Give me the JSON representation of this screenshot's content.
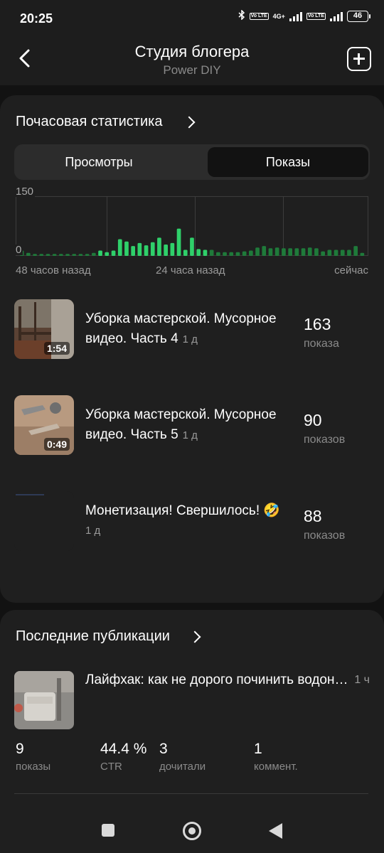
{
  "status_bar": {
    "time": "20:25",
    "network": "4G+",
    "volte": "Vo LTE",
    "battery": "46"
  },
  "header": {
    "title": "Студия блогера",
    "subtitle": "Power DIY",
    "back_icon": "back-arrow-icon",
    "add_icon": "plus-square-icon"
  },
  "hourly": {
    "title": "Почасовая статистика",
    "tabs": [
      {
        "label": "Просмотры",
        "active": false
      },
      {
        "label": "Показы",
        "active": true
      }
    ],
    "chart_data": {
      "type": "bar",
      "ylim": [
        0,
        150
      ],
      "y_ticks": [
        "150",
        "0"
      ],
      "x_ticks": [
        "48 часов назад",
        "24 часа назад",
        "сейчас"
      ],
      "grid": true,
      "colors": {
        "older": "#1f7a3a",
        "recent": "#2fd06a"
      },
      "values": [
        14,
        8,
        5,
        5,
        5,
        5,
        5,
        5,
        5,
        5,
        5,
        8,
        14,
        10,
        14,
        44,
        38,
        26,
        34,
        28,
        36,
        48,
        30,
        34,
        72,
        16,
        48,
        18,
        16,
        16,
        10,
        10,
        10,
        10,
        12,
        14,
        22,
        26,
        20,
        22,
        20,
        20,
        20,
        20,
        22,
        20,
        12,
        16,
        16,
        16,
        16,
        26,
        8
      ],
      "recent_start": 12
    }
  },
  "videos": [
    {
      "title": "Уборка мастерской. Мусорное видео. Часть 4",
      "age": "1 д",
      "duration": "1:54",
      "count": "163",
      "unit": "показа"
    },
    {
      "title": "Уборка мастерской. Мусорное видео. Часть 5",
      "age": "1 д",
      "duration": "0:49",
      "count": "90",
      "unit": "показов"
    },
    {
      "title": "Монетизация! Свершилось! 🤣",
      "age": "1 д",
      "duration": "",
      "count": "88",
      "unit": "показов"
    }
  ],
  "publications": {
    "title": "Последние публикации",
    "item": {
      "title": "Лайфхак: как не дорого починить водонагреватель",
      "age": "1 ч"
    },
    "stats": [
      {
        "value": "9",
        "label": "показы"
      },
      {
        "value": "44.4 %",
        "label": "CTR"
      },
      {
        "value": "3",
        "label": "дочитали"
      },
      {
        "value": "1",
        "label": "коммент."
      }
    ]
  }
}
